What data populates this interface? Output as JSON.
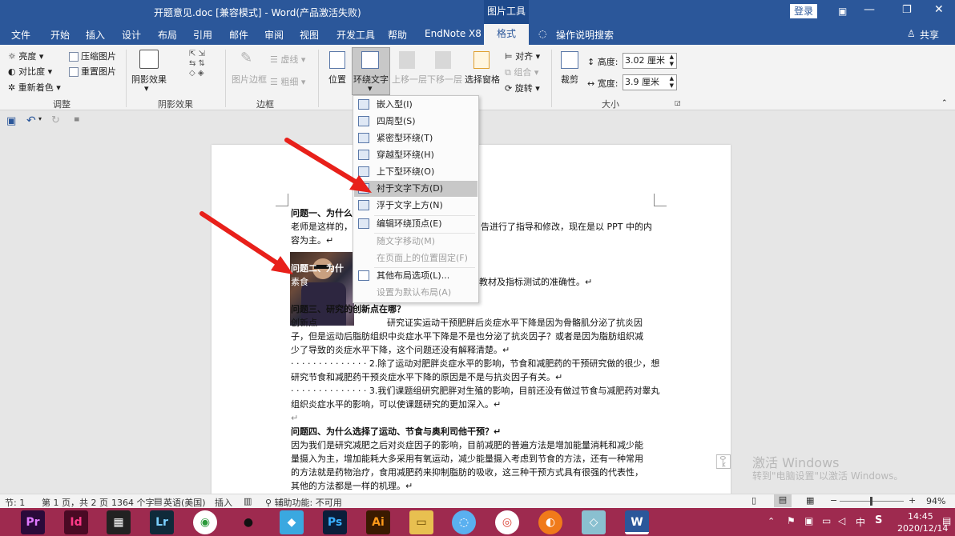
{
  "titlebar": {
    "title": "开题意见.doc [兼容模式] - Word(产品激活失败)",
    "context_tab": "图片工具",
    "login": "登录"
  },
  "tabs": [
    "文件",
    "开始",
    "插入",
    "设计",
    "布局",
    "引用",
    "邮件",
    "审阅",
    "视图",
    "开发工具",
    "帮助",
    "EndNote X8",
    "格式"
  ],
  "tell_me": "操作说明搜索",
  "share": "共享",
  "ribbon": {
    "adjust": {
      "brightness": "亮度",
      "contrast": "对比度",
      "recolor": "重新着色",
      "compress": "压缩图片",
      "reset": "重置图片",
      "group": "调整"
    },
    "shadow": {
      "btn": "阴影效果",
      "group": "阴影效果"
    },
    "border": {
      "btn": "图片边框",
      "dash": "虚线",
      "weight": "粗细",
      "group": "边框"
    },
    "arrange": {
      "position": "位置",
      "wrap": "环绕文字",
      "forward": "上移一层",
      "backward": "下移一层",
      "pane": "选择窗格",
      "align": "对齐",
      "group_btn": "组合",
      "rotate": "旋转"
    },
    "size": {
      "crop": "裁剪",
      "height_label": "高度:",
      "height": "3.02 厘米",
      "width_label": "宽度:",
      "width": "3.9 厘米",
      "group": "大小"
    }
  },
  "wrap_menu": [
    {
      "label": "嵌入型(I)",
      "disabled": false,
      "highlight": false
    },
    {
      "label": "四周型(S)",
      "disabled": false,
      "highlight": false
    },
    {
      "label": "紧密型环绕(T)",
      "disabled": false,
      "highlight": false
    },
    {
      "label": "穿越型环绕(H)",
      "disabled": false,
      "highlight": false
    },
    {
      "label": "上下型环绕(O)",
      "disabled": false,
      "highlight": false
    },
    {
      "label": "衬于文字下方(D)",
      "disabled": false,
      "highlight": true
    },
    {
      "label": "浮于文字上方(N)",
      "disabled": false,
      "highlight": false
    },
    {
      "label": "编辑环绕顶点(E)",
      "disabled": false,
      "highlight": false
    },
    {
      "label": "随文字移动(M)",
      "disabled": true,
      "highlight": false
    },
    {
      "label": "在页面上的位置固定(F)",
      "disabled": true,
      "highlight": false
    },
    {
      "label": "其他布局选项(L)...",
      "disabled": false,
      "highlight": false
    },
    {
      "label": "设置为默认布局(A)",
      "disabled": true,
      "highlight": false
    }
  ],
  "doc": {
    "l1": "问题一、为什么",
    "l2a": "老师是这样的，",
    "l2b": "告进行了指导和修改，现在是以 PPT 中的内",
    "l3": "容为主。↵",
    "l4": "问题二、为什",
    "l5a": "素食",
    "l5b": "教材及指标测试的准确性。↵",
    "l6": "问题三、研究的创新点在哪？",
    "l7a": "创新点",
    "l7b": "研究证实运动干预肥胖后炎症水平下降是因为骨骼肌分泌了抗炎因",
    "l8": "子，但是运动后脂肪组织中炎症水平下降是不是也分泌了抗炎因子？或者是因为脂肪组织减",
    "l9": "少了导致的炎症水平下降，这个问题还没有解释清楚。↵",
    "l10": "· · · · · · · · · · · · · · 2.除了运动对肥胖炎症水平的影响，节食和减肥药的干预研究做的很少，想",
    "l11": "研究节食和减肥药干预炎症水平下降的原因是不是与抗炎因子有关。↵",
    "l12": "· · · · · · · · · · · · · · 3.我们课题组研究肥胖对生殖的影响，目前还没有做过节食与减肥药对睾丸",
    "l13": "组织炎症水平的影响，可以使课题研究的更加深入。↵",
    "l14": "↵",
    "l15": "问题四、为什么选择了运动、节食与奥利司他干预？↵",
    "l16": "因为我们是研究减肥之后对炎症因子的影响，目前减肥的普遍方法是增加能量消耗和减少能",
    "l17": "量摄入为主，增加能耗大多采用有氧运动，减少能量摄入考虑到节食的方法，还有一种常用",
    "l18": "的方法就是药物治疗，食用减肥药来抑制脂肪的吸收，这三种干预方式具有很强的代表性，",
    "l19": "其他的方法都是一样的机理。↵"
  },
  "watermark": {
    "title": "激活 Windows",
    "sub": "转到\"电脑设置\"以激活 Windows。"
  },
  "status": {
    "section": "节: 1",
    "page": "第 1 页，共 2 页",
    "words": "1364 个字",
    "lang": "英语(美国)",
    "mode": "插入",
    "access": "辅助功能: 不可用",
    "zoom": "94%"
  },
  "taskbar": {
    "time": "14:45",
    "date": "2020/12/14",
    "ime": "中",
    "apps": [
      "Pr",
      "Id",
      "▦",
      "Lr",
      "◉",
      "●",
      "◆",
      "Ps",
      "Ai",
      "▭",
      "◌",
      "◎",
      "◐",
      "◇",
      "W"
    ]
  }
}
